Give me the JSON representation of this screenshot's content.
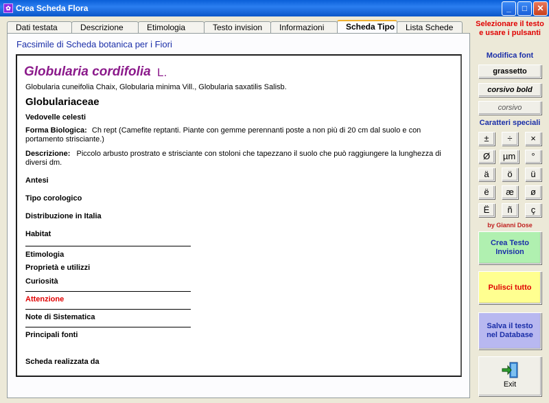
{
  "window": {
    "title": "Crea Scheda Flora",
    "app_icon": "flower-icon"
  },
  "tabs": [
    {
      "label": "Dati testata"
    },
    {
      "label": "Descrizione"
    },
    {
      "label": "Etimologia"
    },
    {
      "label": "Testo invision"
    },
    {
      "label": "Informazioni"
    },
    {
      "label": "Scheda Tipo",
      "active": true
    },
    {
      "label": "Lista Schede"
    }
  ],
  "panel": {
    "heading": "Facsimile di Scheda botanica per i Fiori"
  },
  "sheet": {
    "species": "Globularia cordifolia",
    "author": "L.",
    "synonyms": "Globularia cuneifolia Chaix, Globularia minima Vill., Globularia saxatilis Salisb.",
    "family": "Globulariaceae",
    "common_name": "Vedovelle celesti",
    "forma_label": "Forma Biologica:",
    "forma_value": "Ch rept (Camefite reptanti. Piante con gemme perennanti poste a non più di 20 cm dal suolo e con portamento strisciante.)",
    "descr_label": "Descrizione:",
    "descr_value": "Piccolo arbusto prostrato e strisciante con stoloni che tapezzano il suolo che può raggiungere la lunghezza di diversi dm.",
    "antesi": "Antesi",
    "tipo_corologico": "Tipo corologico",
    "distribuzione": "Distribuzione in Italia",
    "habitat": "Habitat",
    "etimologia": "Etimologia",
    "proprieta": "Proprietà e utilizzi",
    "curiosita": "Curiosità",
    "attenzione": "Attenzione",
    "note": "Note di Sistematica",
    "fonti": "Principali fonti",
    "realizzata": "Scheda realizzata da"
  },
  "sidebar": {
    "instructions": "Selezionare il testo e usare i pulsanti",
    "modifica_font": "Modifica font",
    "font_buttons": [
      "grassetto",
      "corsivo bold",
      "corsivo"
    ],
    "caratteri_speciali": "Caratteri speciali",
    "special_chars": [
      "±",
      "÷",
      "×",
      "Ø",
      "µm",
      "°",
      "ä",
      "ö",
      "ü",
      "ë",
      "æ",
      "ø",
      "Ë",
      "ñ",
      "ç"
    ],
    "credit": "by Gianni Dose",
    "btn_crea": "Crea Testo Invision",
    "btn_pulisci": "Pulisci tutto",
    "btn_salva": "Salva il testo nel Database",
    "btn_exit": "Exit"
  },
  "colors": {
    "title_bar": "#0a5fd8",
    "species": "#8b1a8b",
    "heading_blue": "#1a2ea8",
    "alert_red": "#e00000",
    "crea_green": "#b0f0b0",
    "pulisci_yellow": "#ffff90",
    "salva_blue": "#b8b8f0"
  }
}
